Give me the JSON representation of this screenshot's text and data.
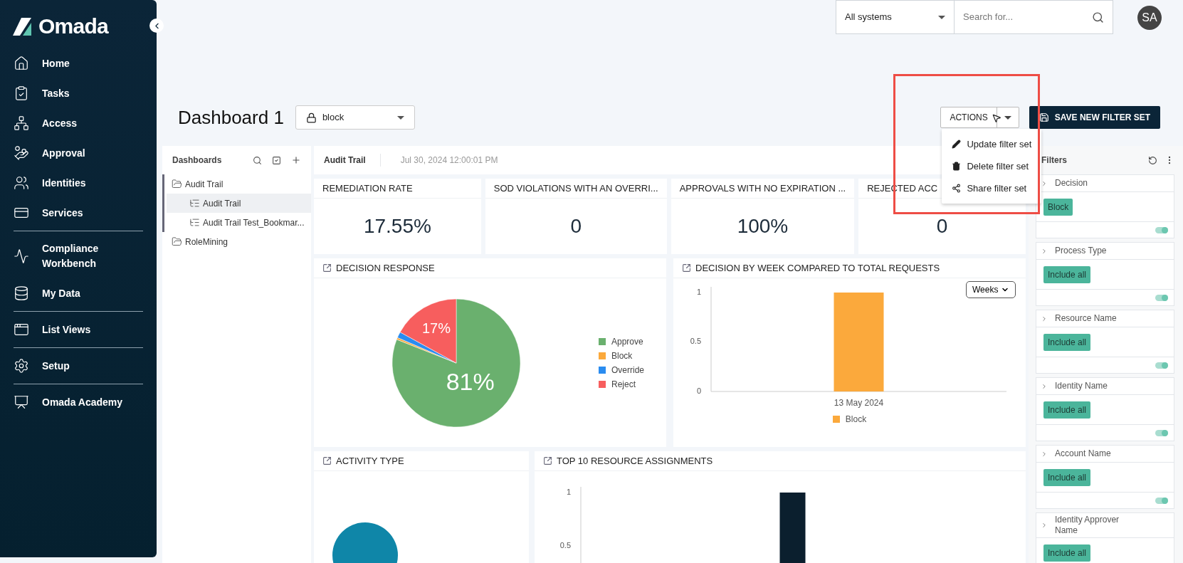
{
  "sidebar": {
    "logo": "Omada",
    "groups": [
      [
        {
          "label": "Home"
        },
        {
          "label": "Tasks"
        },
        {
          "label": "Access"
        },
        {
          "label": "Approval"
        },
        {
          "label": "Identities"
        },
        {
          "label": "Services"
        }
      ],
      [
        {
          "label": "Compliance Workbench"
        },
        {
          "label": "My Data"
        }
      ],
      [
        {
          "label": "List Views"
        }
      ],
      [
        {
          "label": "Setup"
        }
      ],
      [
        {
          "label": "Omada Academy"
        }
      ]
    ]
  },
  "topbar": {
    "system_select": "All systems",
    "search": {
      "placeholder": "Search for..."
    },
    "avatar": "SA"
  },
  "page": {
    "title": "Dashboard 1",
    "filter_set": "block",
    "actions_button": "ACTIONS",
    "save_button": "SAVE NEW FILTER SET",
    "actions_menu": [
      {
        "kind": "edit",
        "label": "Update filter set"
      },
      {
        "kind": "delete",
        "label": "Delete filter set"
      },
      {
        "kind": "share",
        "label": "Share filter set"
      }
    ]
  },
  "dashboards": {
    "title": "Dashboards",
    "items": [
      {
        "label": "Audit Trail",
        "kind": "folder",
        "expanded": true,
        "selected": false,
        "children": [
          {
            "label": "Audit Trail",
            "kind": "dashboard",
            "selected": true
          },
          {
            "label": "Audit Trail Test_Bookmar...",
            "kind": "dashboard",
            "selected": false
          }
        ]
      },
      {
        "label": "RoleMining",
        "kind": "folder",
        "expanded": false,
        "selected": false
      }
    ]
  },
  "dashboard": {
    "tab": "Audit Trail",
    "timestamp": "Jul 30, 2024 12:00:01 PM",
    "kpis": [
      {
        "title": "REMEDIATION RATE",
        "value": "17.55%"
      },
      {
        "title": "SOD VIOLATIONS WITH AN OVERRI...",
        "value": "0"
      },
      {
        "title": "APPROVALS WITH NO EXPIRATION ...",
        "value": "100%"
      },
      {
        "title": "REJECTED ACC",
        "value": "0"
      }
    ],
    "decision_response": {
      "title": "DECISION RESPONSE",
      "chart_data": {
        "type": "pie",
        "categories": [
          "Approve",
          "Block",
          "Override",
          "Reject"
        ],
        "colors": [
          "#6ab06e",
          "#fba93c",
          "#2a8cf0",
          "#f75e5e"
        ],
        "values": [
          81,
          0.5,
          1.5,
          17
        ],
        "value_labels": [
          "81%",
          null,
          null,
          "17%"
        ]
      }
    },
    "decision_by_week": {
      "title": "DECISION BY WEEK COMPARED TO TOTAL REQUESTS",
      "period_select": "Weeks",
      "chart_data": {
        "type": "bar",
        "categories": [
          "13 May 2024"
        ],
        "series": [
          {
            "name": "Block",
            "color": "#fba93c",
            "values": [
              1
            ]
          }
        ],
        "ylim": [
          0,
          1
        ],
        "yticks": [
          0,
          0.5,
          1
        ]
      }
    },
    "activity_type": {
      "title": "ACTIVITY TYPE"
    },
    "top_resources": {
      "title": "TOP 10 RESOURCE ASSIGNMENTS",
      "chart_data": {
        "type": "bar",
        "series": [
          {
            "color": "#0b1f2e",
            "values": [
              1
            ]
          }
        ],
        "ylim": [
          0,
          1
        ],
        "yticks": [
          0.5,
          1
        ]
      }
    }
  },
  "filters": {
    "title": "Filters",
    "items": [
      {
        "label": "Decision",
        "chip": "Block",
        "on": true
      },
      {
        "label": "Process Type",
        "chip": "Include all",
        "on": true
      },
      {
        "label": "Resource Name",
        "chip": "Include all",
        "on": true
      },
      {
        "label": "Identity Name",
        "chip": "Include all",
        "on": true
      },
      {
        "label": "Account Name",
        "chip": "Include all",
        "on": true
      },
      {
        "label": "Identity Approver Name",
        "chip": "Include all"
      }
    ]
  }
}
